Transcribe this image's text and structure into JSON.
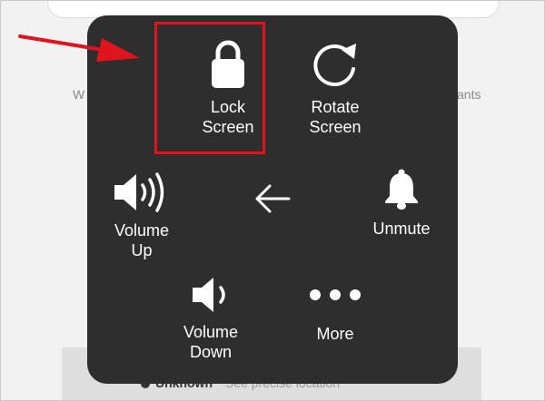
{
  "background": {
    "left_text": "W",
    "right_text": "ants",
    "bottom_strong": "Unknown",
    "bottom_faint": "See precise location"
  },
  "menu": {
    "items": [
      {
        "key": "lock",
        "label": "Lock\nScreen",
        "icon": "lock-icon"
      },
      {
        "key": "rotate",
        "label": "Rotate\nScreen",
        "icon": "rotate-icon"
      },
      {
        "key": "volume_up",
        "label": "Volume\nUp",
        "icon": "volume-up-icon"
      },
      {
        "key": "back",
        "label": "",
        "icon": "back-arrow-icon"
      },
      {
        "key": "unmute",
        "label": "Unmute",
        "icon": "bell-icon"
      },
      {
        "key": "volume_down",
        "label": "Volume\nDown",
        "icon": "volume-down-icon"
      },
      {
        "key": "more",
        "label": "More",
        "icon": "more-dots-icon"
      }
    ]
  },
  "colors": {
    "menu_bg": "#2e2e2e",
    "icon_white": "#ffffff",
    "annotation_red": "#e0141e"
  }
}
